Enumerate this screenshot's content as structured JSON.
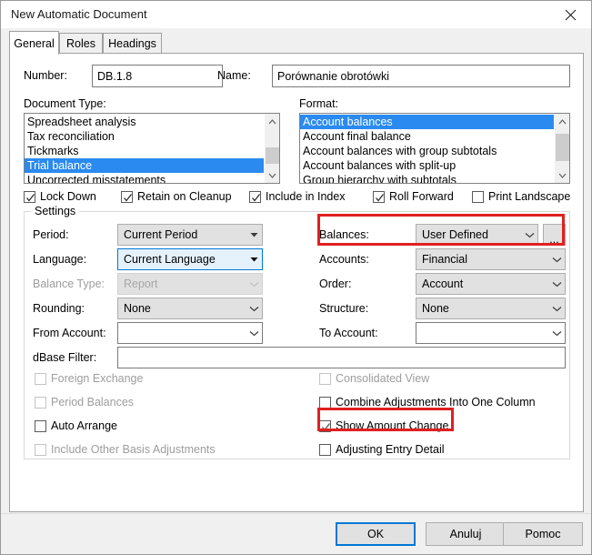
{
  "window": {
    "title": "New Automatic Document",
    "close_icon": "close-icon"
  },
  "tabs": [
    {
      "label": "General",
      "active": true
    },
    {
      "label": "Roles",
      "active": false
    },
    {
      "label": "Headings",
      "active": false
    }
  ],
  "fields": {
    "number_label": "Number:",
    "number_value": "DB.1.8",
    "name_label": "Name:",
    "name_value": "Porównanie obrotówki"
  },
  "document_type": {
    "label": "Document Type:",
    "items": [
      "Spreadsheet analysis",
      "Tax reconciliation",
      "Tickmarks",
      "Trial balance",
      "Uncorrected misstatements"
    ],
    "selected": "Trial balance"
  },
  "format": {
    "label": "Format:",
    "items": [
      "Account balances",
      "Account final balance",
      "Account balances with group subtotals",
      "Account balances with split-up",
      "Group hierarchy with subtotals"
    ],
    "selected": "Account balances"
  },
  "top_checkboxes": [
    {
      "label": "Lock Down",
      "checked": true,
      "disabled": false
    },
    {
      "label": "Retain on Cleanup",
      "checked": true,
      "disabled": false
    },
    {
      "label": "Include in Index",
      "checked": true,
      "disabled": false
    },
    {
      "label": "Roll Forward",
      "checked": true,
      "disabled": false
    },
    {
      "label": "Print Landscape",
      "checked": false,
      "disabled": false
    }
  ],
  "settings": {
    "title": "Settings",
    "left_rows": [
      {
        "label": "Period:",
        "value": "Current Period",
        "state": "normal"
      },
      {
        "label": "Language:",
        "value": "Current Language",
        "state": "focused"
      },
      {
        "label": "Balance Type:",
        "value": "Report",
        "state": "disabled"
      },
      {
        "label": "Rounding:",
        "value": "None",
        "state": "normal"
      },
      {
        "label": "From Account:",
        "value": "",
        "state": "empty"
      }
    ],
    "right_rows": [
      {
        "label": "Balances:",
        "value": "User Defined",
        "state": "normal",
        "ellipsis": "..."
      },
      {
        "label": "Accounts:",
        "value": "Financial",
        "state": "normal"
      },
      {
        "label": "Order:",
        "value": "Account",
        "state": "normal"
      },
      {
        "label": "Structure:",
        "value": "None",
        "state": "normal"
      },
      {
        "label": "To Account:",
        "value": "",
        "state": "empty"
      }
    ],
    "dbase_filter_label": "dBase Filter:",
    "dbase_filter_value": "",
    "left_checkboxes": [
      {
        "label": "Foreign Exchange",
        "checked": false,
        "disabled": true
      },
      {
        "label": "Period Balances",
        "checked": false,
        "disabled": true
      },
      {
        "label": "Auto Arrange",
        "checked": false,
        "disabled": false
      },
      {
        "label": "Include Other Basis Adjustments",
        "checked": false,
        "disabled": true
      }
    ],
    "right_checkboxes": [
      {
        "label": "Consolidated View",
        "checked": false,
        "disabled": true
      },
      {
        "label": "Combine Adjustments Into One Column",
        "checked": false,
        "disabled": false
      },
      {
        "label": "Show Amount Change",
        "checked": true,
        "disabled": false
      },
      {
        "label": "Adjusting Entry Detail",
        "checked": false,
        "disabled": false
      }
    ]
  },
  "buttons": {
    "ok": "OK",
    "cancel": "Anuluj",
    "help": "Pomoc"
  },
  "colors": {
    "highlight_red": "#e02020",
    "selection_blue": "#2a8af0",
    "focus_blue": "#0078d7"
  }
}
